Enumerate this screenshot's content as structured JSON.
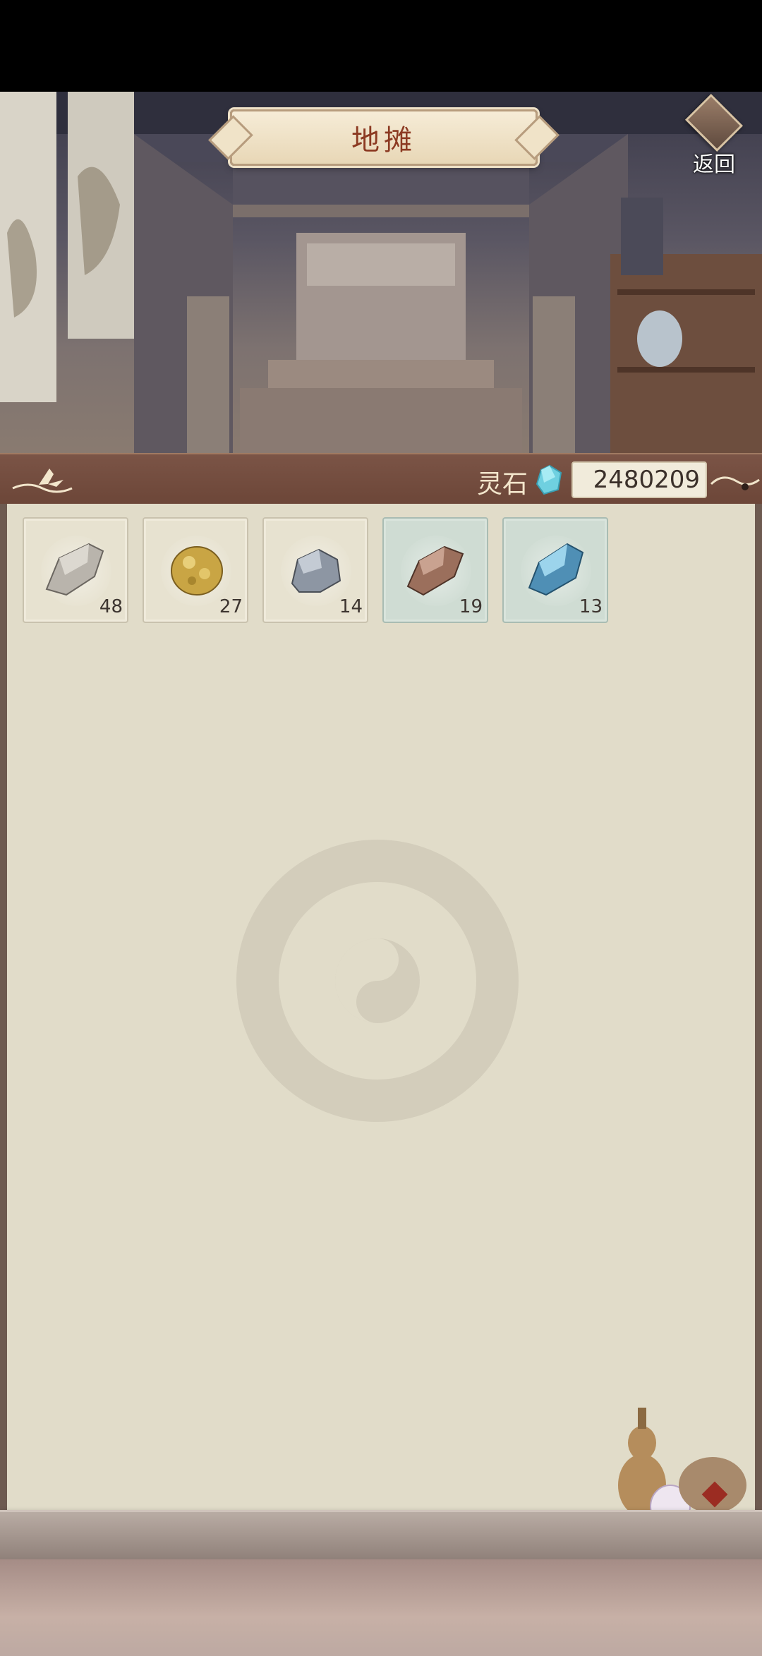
{
  "header": {
    "title": "地摊",
    "back_label": "返回"
  },
  "currency": {
    "label": "灵石",
    "value": "2480209",
    "icon": "spirit-stone-icon"
  },
  "items": [
    {
      "name": "gray-stone-icon",
      "count": "48",
      "highlight": false
    },
    {
      "name": "gold-ore-icon",
      "count": "27",
      "highlight": false
    },
    {
      "name": "iron-ore-icon",
      "count": "14",
      "highlight": false
    },
    {
      "name": "copper-ore-icon",
      "count": "19",
      "highlight": true
    },
    {
      "name": "blue-crystal-icon",
      "count": "13",
      "highlight": true
    }
  ],
  "colors": {
    "paper": "#e1dcc9",
    "bar": "#6c4638",
    "title_text": "#8c3a22",
    "slot_teal": "#cfdcd3"
  }
}
